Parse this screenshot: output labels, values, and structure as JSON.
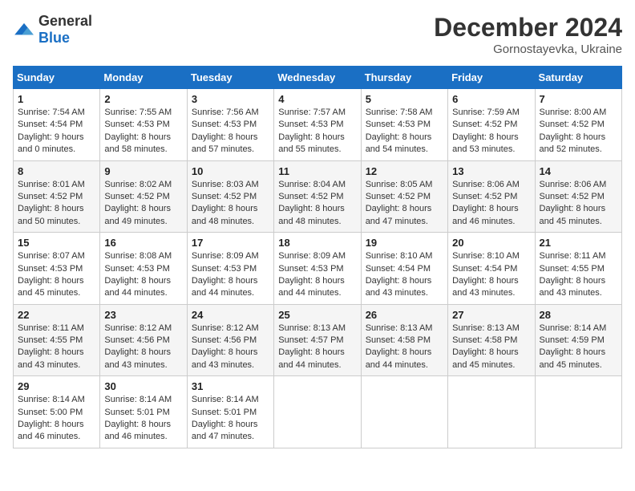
{
  "logo": {
    "general": "General",
    "blue": "Blue"
  },
  "header": {
    "title": "December 2024",
    "subtitle": "Gornostayevka, Ukraine"
  },
  "days_of_week": [
    "Sunday",
    "Monday",
    "Tuesday",
    "Wednesday",
    "Thursday",
    "Friday",
    "Saturday"
  ],
  "weeks": [
    [
      {
        "day": "1",
        "sunrise": "7:54 AM",
        "sunset": "4:54 PM",
        "daylight": "9 hours and 0 minutes."
      },
      {
        "day": "2",
        "sunrise": "7:55 AM",
        "sunset": "4:53 PM",
        "daylight": "8 hours and 58 minutes."
      },
      {
        "day": "3",
        "sunrise": "7:56 AM",
        "sunset": "4:53 PM",
        "daylight": "8 hours and 57 minutes."
      },
      {
        "day": "4",
        "sunrise": "7:57 AM",
        "sunset": "4:53 PM",
        "daylight": "8 hours and 55 minutes."
      },
      {
        "day": "5",
        "sunrise": "7:58 AM",
        "sunset": "4:53 PM",
        "daylight": "8 hours and 54 minutes."
      },
      {
        "day": "6",
        "sunrise": "7:59 AM",
        "sunset": "4:52 PM",
        "daylight": "8 hours and 53 minutes."
      },
      {
        "day": "7",
        "sunrise": "8:00 AM",
        "sunset": "4:52 PM",
        "daylight": "8 hours and 52 minutes."
      }
    ],
    [
      {
        "day": "8",
        "sunrise": "8:01 AM",
        "sunset": "4:52 PM",
        "daylight": "8 hours and 50 minutes."
      },
      {
        "day": "9",
        "sunrise": "8:02 AM",
        "sunset": "4:52 PM",
        "daylight": "8 hours and 49 minutes."
      },
      {
        "day": "10",
        "sunrise": "8:03 AM",
        "sunset": "4:52 PM",
        "daylight": "8 hours and 48 minutes."
      },
      {
        "day": "11",
        "sunrise": "8:04 AM",
        "sunset": "4:52 PM",
        "daylight": "8 hours and 48 minutes."
      },
      {
        "day": "12",
        "sunrise": "8:05 AM",
        "sunset": "4:52 PM",
        "daylight": "8 hours and 47 minutes."
      },
      {
        "day": "13",
        "sunrise": "8:06 AM",
        "sunset": "4:52 PM",
        "daylight": "8 hours and 46 minutes."
      },
      {
        "day": "14",
        "sunrise": "8:06 AM",
        "sunset": "4:52 PM",
        "daylight": "8 hours and 45 minutes."
      }
    ],
    [
      {
        "day": "15",
        "sunrise": "8:07 AM",
        "sunset": "4:53 PM",
        "daylight": "8 hours and 45 minutes."
      },
      {
        "day": "16",
        "sunrise": "8:08 AM",
        "sunset": "4:53 PM",
        "daylight": "8 hours and 44 minutes."
      },
      {
        "day": "17",
        "sunrise": "8:09 AM",
        "sunset": "4:53 PM",
        "daylight": "8 hours and 44 minutes."
      },
      {
        "day": "18",
        "sunrise": "8:09 AM",
        "sunset": "4:53 PM",
        "daylight": "8 hours and 44 minutes."
      },
      {
        "day": "19",
        "sunrise": "8:10 AM",
        "sunset": "4:54 PM",
        "daylight": "8 hours and 43 minutes."
      },
      {
        "day": "20",
        "sunrise": "8:10 AM",
        "sunset": "4:54 PM",
        "daylight": "8 hours and 43 minutes."
      },
      {
        "day": "21",
        "sunrise": "8:11 AM",
        "sunset": "4:55 PM",
        "daylight": "8 hours and 43 minutes."
      }
    ],
    [
      {
        "day": "22",
        "sunrise": "8:11 AM",
        "sunset": "4:55 PM",
        "daylight": "8 hours and 43 minutes."
      },
      {
        "day": "23",
        "sunrise": "8:12 AM",
        "sunset": "4:56 PM",
        "daylight": "8 hours and 43 minutes."
      },
      {
        "day": "24",
        "sunrise": "8:12 AM",
        "sunset": "4:56 PM",
        "daylight": "8 hours and 43 minutes."
      },
      {
        "day": "25",
        "sunrise": "8:13 AM",
        "sunset": "4:57 PM",
        "daylight": "8 hours and 44 minutes."
      },
      {
        "day": "26",
        "sunrise": "8:13 AM",
        "sunset": "4:58 PM",
        "daylight": "8 hours and 44 minutes."
      },
      {
        "day": "27",
        "sunrise": "8:13 AM",
        "sunset": "4:58 PM",
        "daylight": "8 hours and 45 minutes."
      },
      {
        "day": "28",
        "sunrise": "8:14 AM",
        "sunset": "4:59 PM",
        "daylight": "8 hours and 45 minutes."
      }
    ],
    [
      {
        "day": "29",
        "sunrise": "8:14 AM",
        "sunset": "5:00 PM",
        "daylight": "8 hours and 46 minutes."
      },
      {
        "day": "30",
        "sunrise": "8:14 AM",
        "sunset": "5:01 PM",
        "daylight": "8 hours and 46 minutes."
      },
      {
        "day": "31",
        "sunrise": "8:14 AM",
        "sunset": "5:01 PM",
        "daylight": "8 hours and 47 minutes."
      },
      null,
      null,
      null,
      null
    ]
  ]
}
